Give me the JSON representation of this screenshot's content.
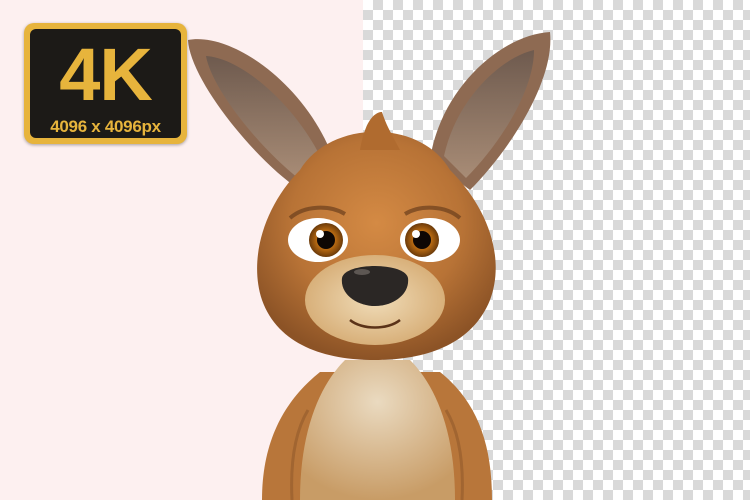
{
  "badge": {
    "resolution_label": "4K",
    "dimensions_text": "4096 x 4096px"
  },
  "colors": {
    "left_background": "#fdf0f0",
    "checker_light": "#ffffff",
    "checker_dark": "#d9d9d9",
    "badge_gold": "#e7b43c",
    "badge_dark": "#1c1a17",
    "fur_orange": "#c9843f",
    "fur_cream": "#e8d3ad"
  },
  "subject": {
    "icon": "kangaroo-icon"
  }
}
